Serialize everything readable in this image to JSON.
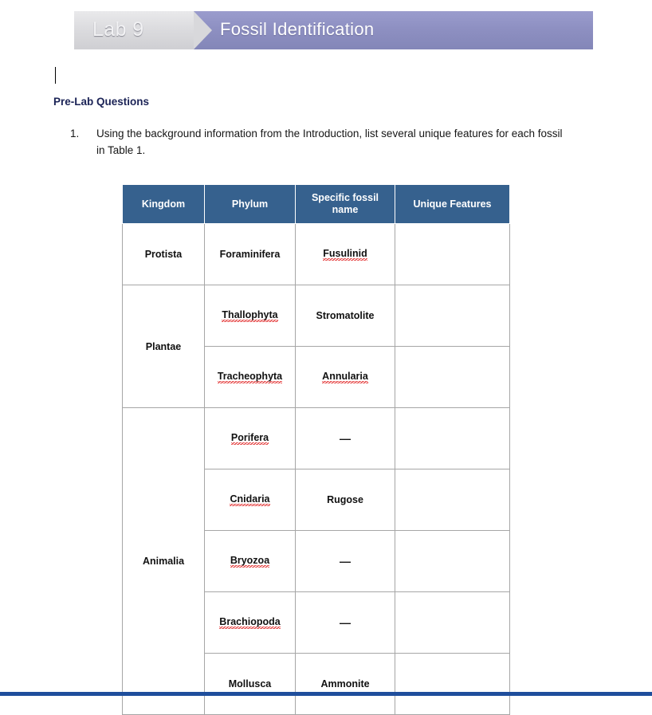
{
  "banner": {
    "lab_label": "Lab 9",
    "title": "Fossil Identification",
    "grey_color": "#d8d8db",
    "purple_color": "#8e90c2"
  },
  "document": {
    "section_heading": "Pre-Lab Questions",
    "heading_color": "#1b2356",
    "questions": [
      {
        "number": "1.",
        "text": "Using the background information from the Introduction, list several unique features for each fossil in Table 1."
      }
    ]
  },
  "table": {
    "header_color": "#36618E",
    "columns": [
      "Kingdom",
      "Phylum",
      "Specific fossil name",
      "Unique Features"
    ],
    "rows": [
      {
        "kingdom": "Protista",
        "kingdom_rowspan": 1,
        "phylum": "Foraminifera",
        "phylum_misspelled": false,
        "fossil": "Fusulinid",
        "fossil_misspelled": true,
        "unique": ""
      },
      {
        "kingdom": "Plantae",
        "kingdom_rowspan": 2,
        "phylum": "Thallophyta",
        "phylum_misspelled": true,
        "fossil": "Stromatolite",
        "fossil_misspelled": false,
        "unique": ""
      },
      {
        "kingdom": null,
        "phylum": "Tracheophyta",
        "phylum_misspelled": true,
        "fossil": "Annularia",
        "fossil_misspelled": true,
        "unique": ""
      },
      {
        "kingdom": "Animalia",
        "kingdom_rowspan": 5,
        "phylum": "Porifera",
        "phylum_misspelled": true,
        "fossil": "—",
        "fossil_misspelled": false,
        "unique": ""
      },
      {
        "kingdom": null,
        "phylum": "Cnidaria",
        "phylum_misspelled": true,
        "fossil": "Rugose",
        "fossil_misspelled": false,
        "unique": ""
      },
      {
        "kingdom": null,
        "phylum": "Bryozoa",
        "phylum_misspelled": true,
        "fossil": "—",
        "fossil_misspelled": false,
        "unique": ""
      },
      {
        "kingdom": null,
        "phylum": "Brachiopoda",
        "phylum_misspelled": true,
        "fossil": "—",
        "fossil_misspelled": false,
        "unique": ""
      },
      {
        "kingdom": null,
        "phylum": "Mollusca",
        "phylum_misspelled": false,
        "fossil": "Ammonite",
        "fossil_misspelled": false,
        "unique": ""
      }
    ]
  },
  "bottom_strip": {
    "color": "#1f4e9c"
  }
}
